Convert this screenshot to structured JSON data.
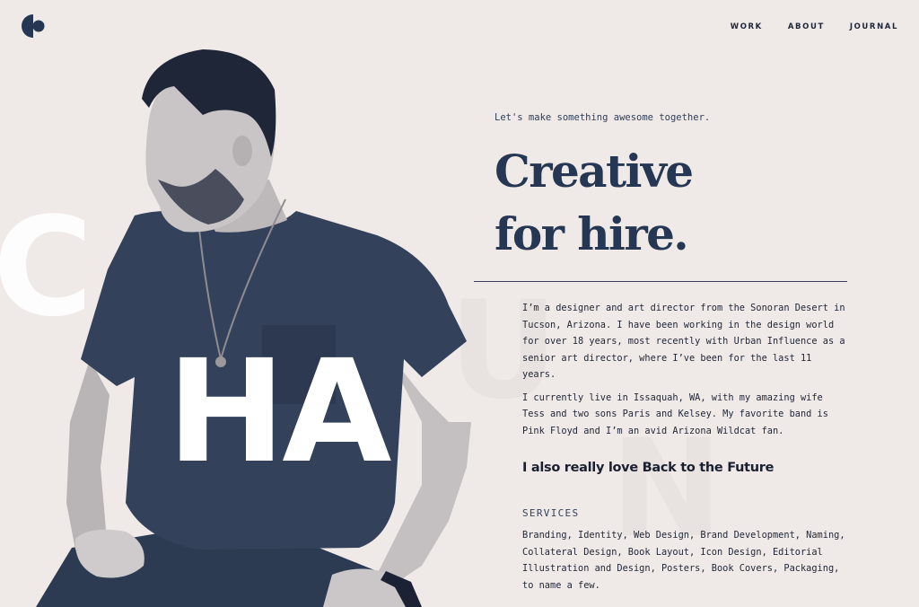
{
  "brand": {
    "logo_icon": "half-circle-dot-logo-icon",
    "accent": "#253752",
    "background": "#efe9e7"
  },
  "nav": {
    "items": [
      {
        "label": "WORK"
      },
      {
        "label": "ABOUT"
      },
      {
        "label": "JOURNAL"
      }
    ]
  },
  "hero": {
    "letters": {
      "c": "C",
      "h": "HA",
      "u": "U",
      "n": "N"
    },
    "tagline": "Let's make something awesome together.",
    "headline_line1": "Creative",
    "headline_line2": "for hire."
  },
  "about": {
    "paragraphs": [
      "I’m a designer and art director from the Sonoran Desert in Tucson, Arizona. I have been working in the design world for over 18 years, most recently with Urban Influence as a senior art director, where I’ve been for the last 11 years.",
      "I currently live in Issaquah, WA, with my amazing wife Tess and two sons Paris and Kelsey. My favorite band is Pink Floyd and I’m an avid Arizona Wildcat fan."
    ],
    "callout": "I also really love Back to the Future"
  },
  "services": {
    "title": "SERVICES",
    "list": "Branding, Identity, Web Design, Brand Development, Naming, Collateral Design, Book Layout, Icon Design, Editorial Illustration and Design, Posters, Book Covers, Packaging, to name a few."
  }
}
